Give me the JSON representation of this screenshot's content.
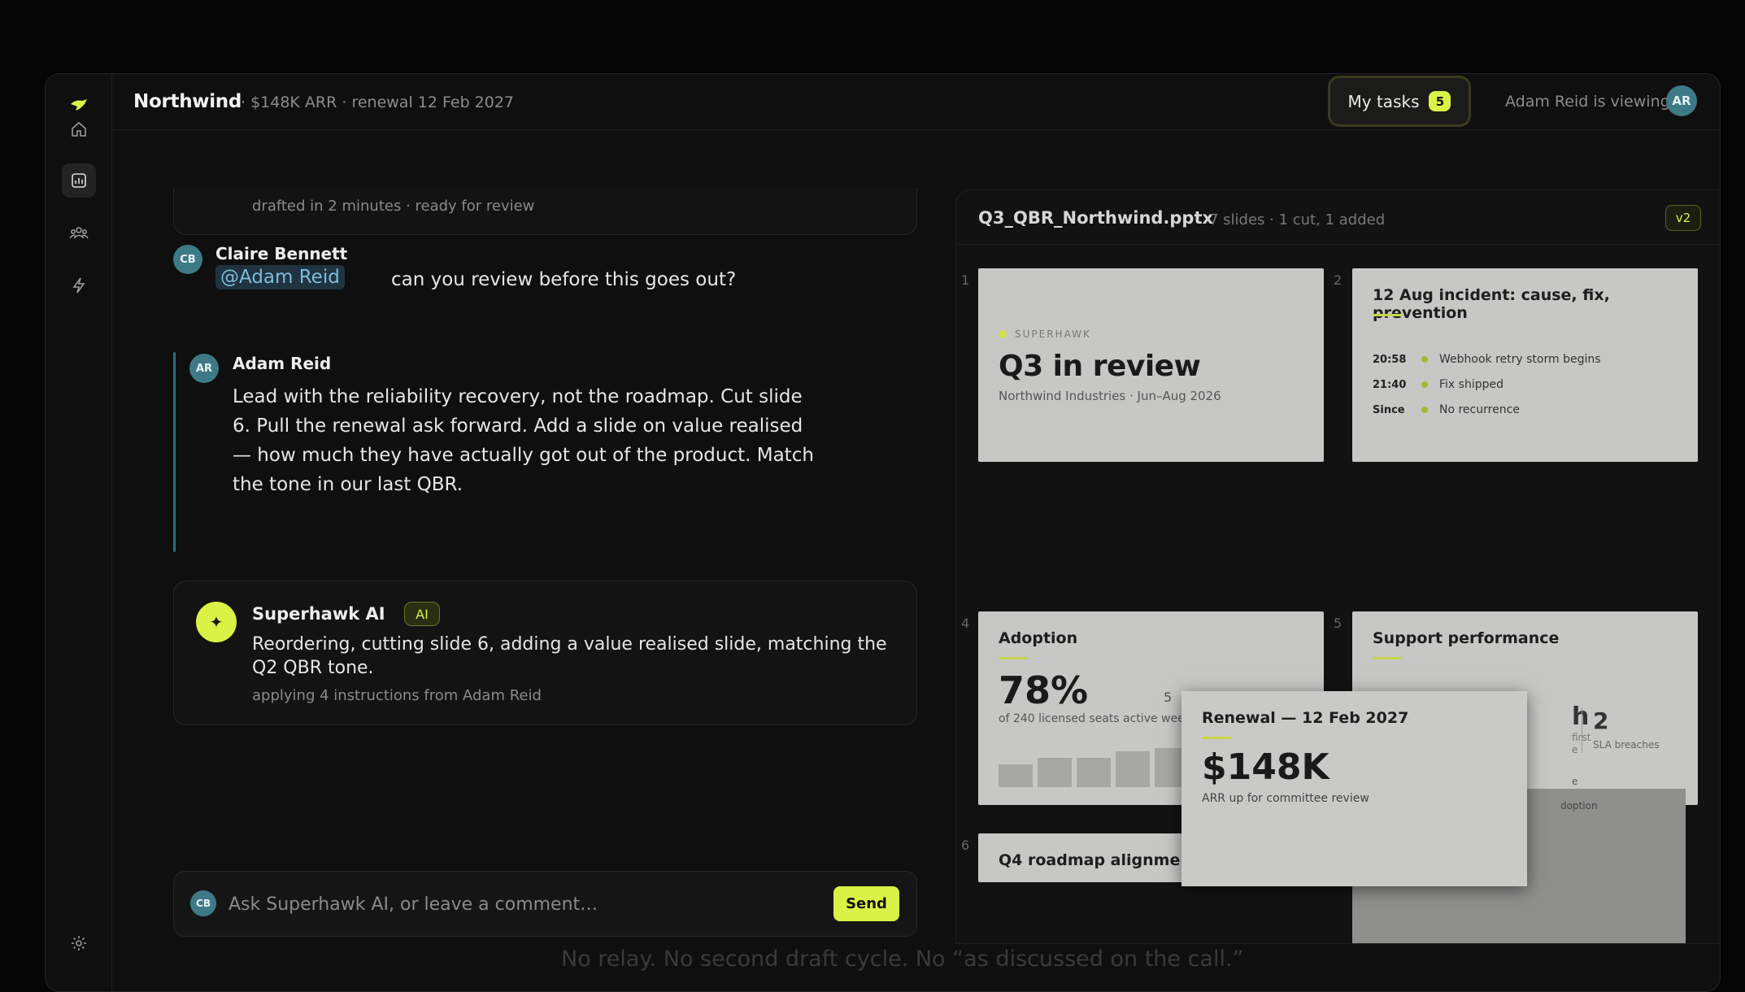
{
  "topbar": {
    "brand": "Northwind",
    "meta": "· $148K ARR · renewal 12 Feb 2027",
    "tasks_label": "My tasks",
    "tasks_count": "5",
    "viewing": "Adam Reid is viewing",
    "viewer_initials": "AR"
  },
  "rail": {
    "items": [
      "home-icon",
      "chart-icon",
      "users-icon",
      "bolt-icon"
    ],
    "settings": "gear-icon"
  },
  "chat": {
    "draft_status": "drafted in 2 minutes · ready for review",
    "messages": [
      {
        "initials": "CB",
        "author": "Claire Bennett",
        "mention": "@Adam Reid",
        "text": "can you review before this goes out?"
      },
      {
        "initials": "AR",
        "author": "Adam Reid",
        "text": "Lead with the reliability recovery, not the roadmap. Cut slide 6. Pull the renewal ask forward. Add a slide on value realised — how much they have actually got out of the product. Match the tone in our last QBR."
      }
    ],
    "ai": {
      "author": "Superhawk AI",
      "badge": "AI",
      "text": "Reordering, cutting slide 6, adding a value realised slide, matching the Q2 QBR tone.",
      "sub": "applying 4 instructions from Adam Reid"
    },
    "composer": {
      "initials": "CB",
      "placeholder": "Ask Superhawk AI, or leave a comment…",
      "send_label": "Send"
    }
  },
  "deck": {
    "filename": "Q3_QBR_Northwind.pptx",
    "meta": "7 slides · 1 cut, 1 added",
    "version": "v2",
    "slides": [
      {
        "num": "1",
        "eyebrow": "SUPERHAWK",
        "title": "Q3 in review",
        "sub": "Northwind Industries · Jun–Aug 2026"
      },
      {
        "num": "2",
        "title": "12 Aug incident: cause, fix, prevention",
        "rows": [
          {
            "time": "20:58",
            "text": "Webhook retry storm begins"
          },
          {
            "time": "21:40",
            "text": "Fix shipped"
          },
          {
            "time": "Since",
            "text": "No recurrence"
          }
        ]
      },
      {
        "num": "4",
        "title": "Adoption",
        "value": "78%",
        "sub": "of 240 licensed seats active wee",
        "bars": [
          0.35,
          0.45,
          0.45,
          0.55,
          0.6
        ]
      },
      {
        "num": "5",
        "title": "Support performance",
        "value": "2",
        "value_label": "SLA breaches",
        "partial": [
          "h",
          "first",
          "e",
          "e",
          "doption"
        ]
      },
      {
        "num": "6",
        "title": "Q4 roadmap alignment"
      }
    ],
    "dragged": {
      "num": "5",
      "title": "Renewal — 12 Feb 2027",
      "value": "$148K",
      "sub": "ARR up for committee review"
    }
  },
  "footer_caption": "No relay. No second draft cycle. No “as discussed on the call.”",
  "colors": {
    "accent": "#d9f245",
    "avatar": "#3e7a86",
    "mention_bg": "#1f3341"
  }
}
